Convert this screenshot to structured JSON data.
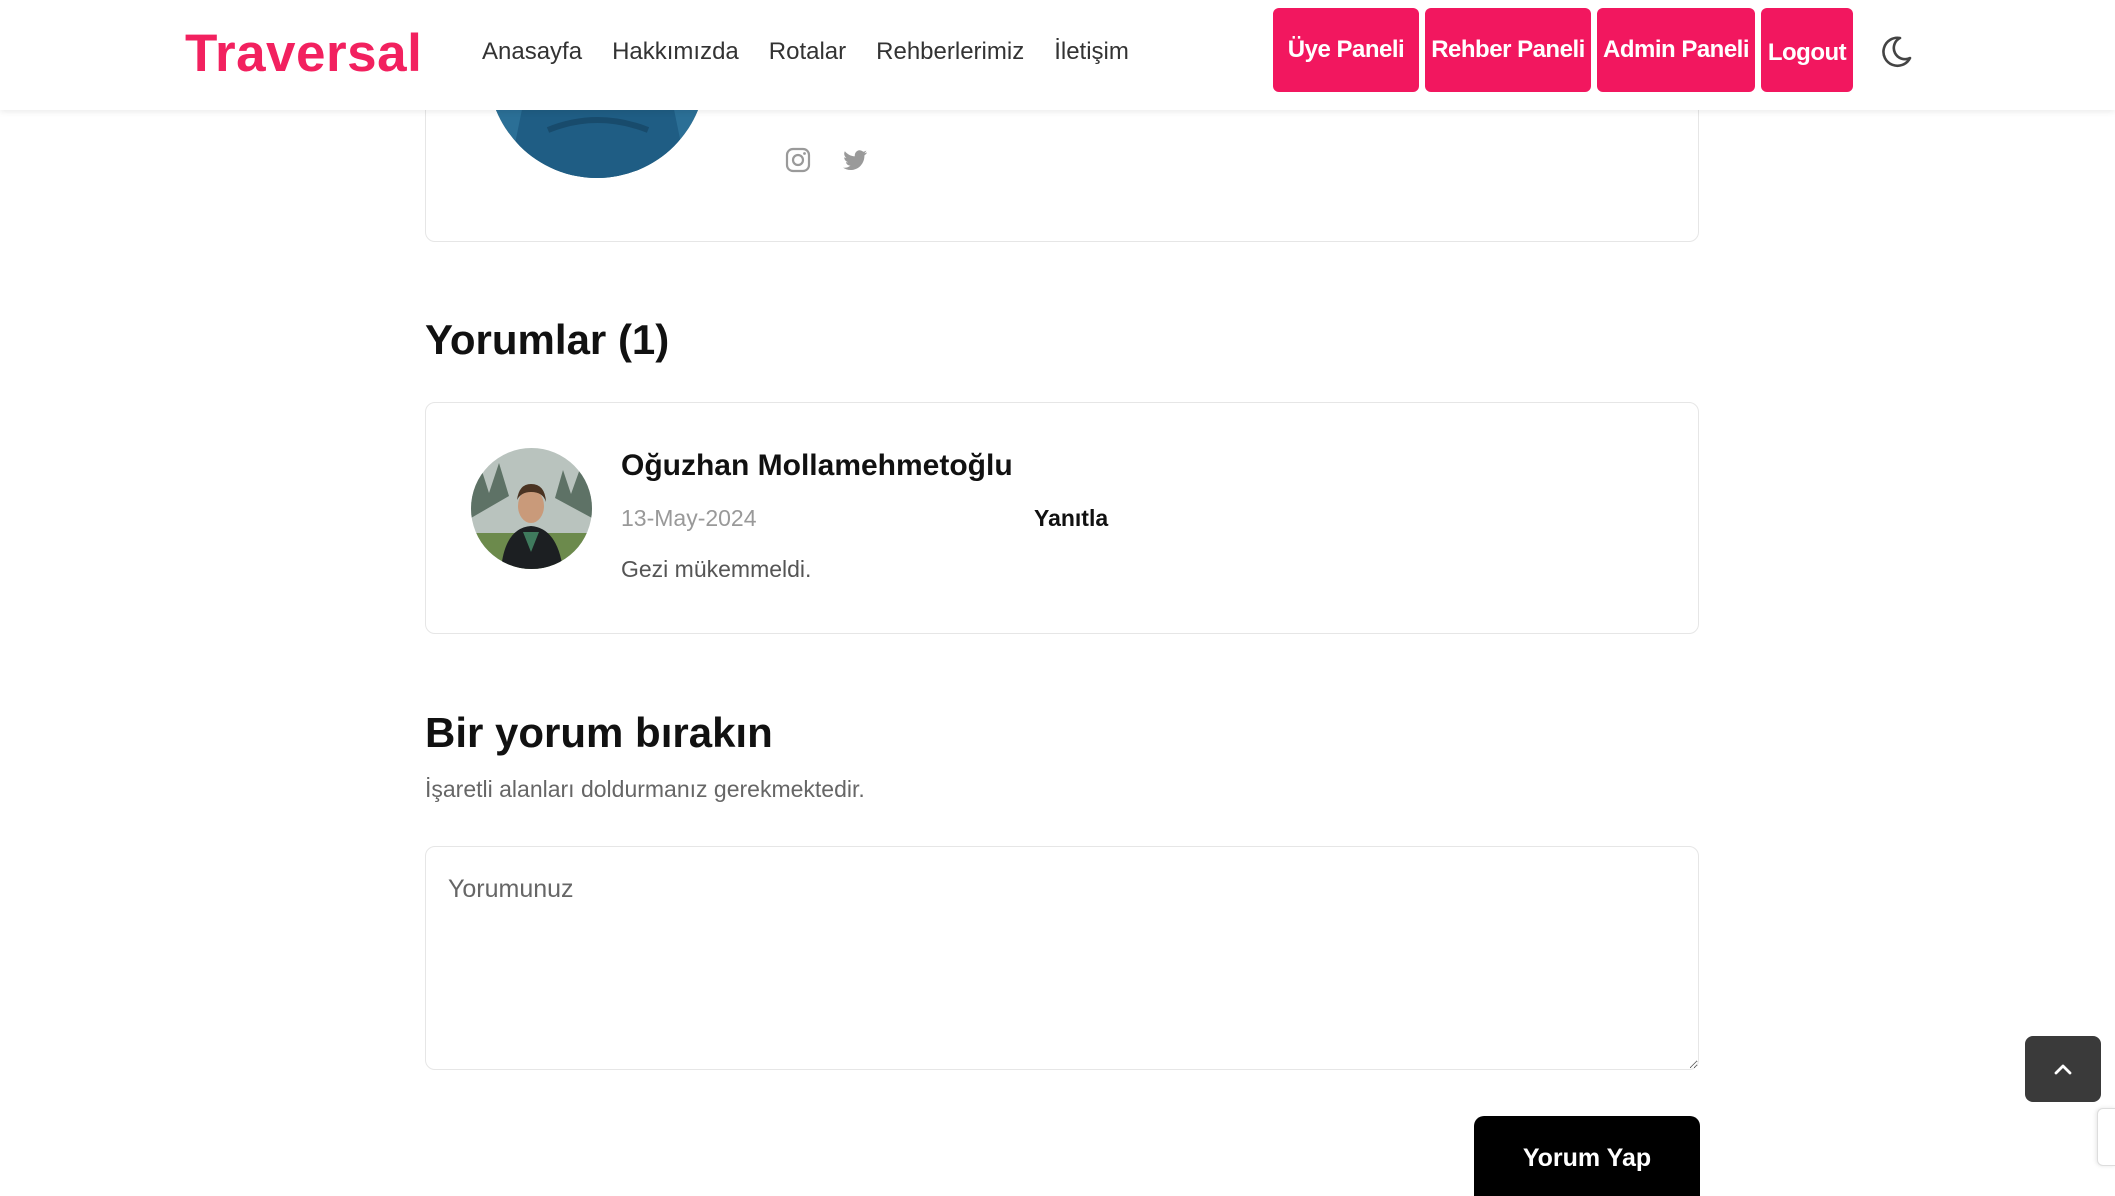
{
  "brand": {
    "name": "Traversal",
    "color": "#f2215f"
  },
  "nav": {
    "links": [
      "Anasayfa",
      "Hakkımızda",
      "Rotalar",
      "Rehberlerimiz",
      "İletişim"
    ],
    "buttons": [
      "Üye Paneli",
      "Rehber Paneli",
      "Admin Paneli",
      "Logout"
    ],
    "button_color": "#f2175f",
    "theme_toggle_icon": "moon-icon"
  },
  "author_card": {
    "social_icons": [
      "instagram-icon",
      "twitter-icon"
    ]
  },
  "comments": {
    "title": "Yorumlar (1)",
    "items": [
      {
        "author": "Oğuzhan Mollamehmetoğlu",
        "date": "13-May-2024",
        "reply_label": "Yanıtla",
        "text": "Gezi mükemmeldi."
      }
    ]
  },
  "comment_form": {
    "title": "Bir yorum bırakın",
    "note": "İşaretli alanları doldurmanız gerekmektedir.",
    "placeholder": "Yorumunuz",
    "submit_label": "Yorum Yap"
  },
  "back_to_top_icon": "chevron-up-icon"
}
